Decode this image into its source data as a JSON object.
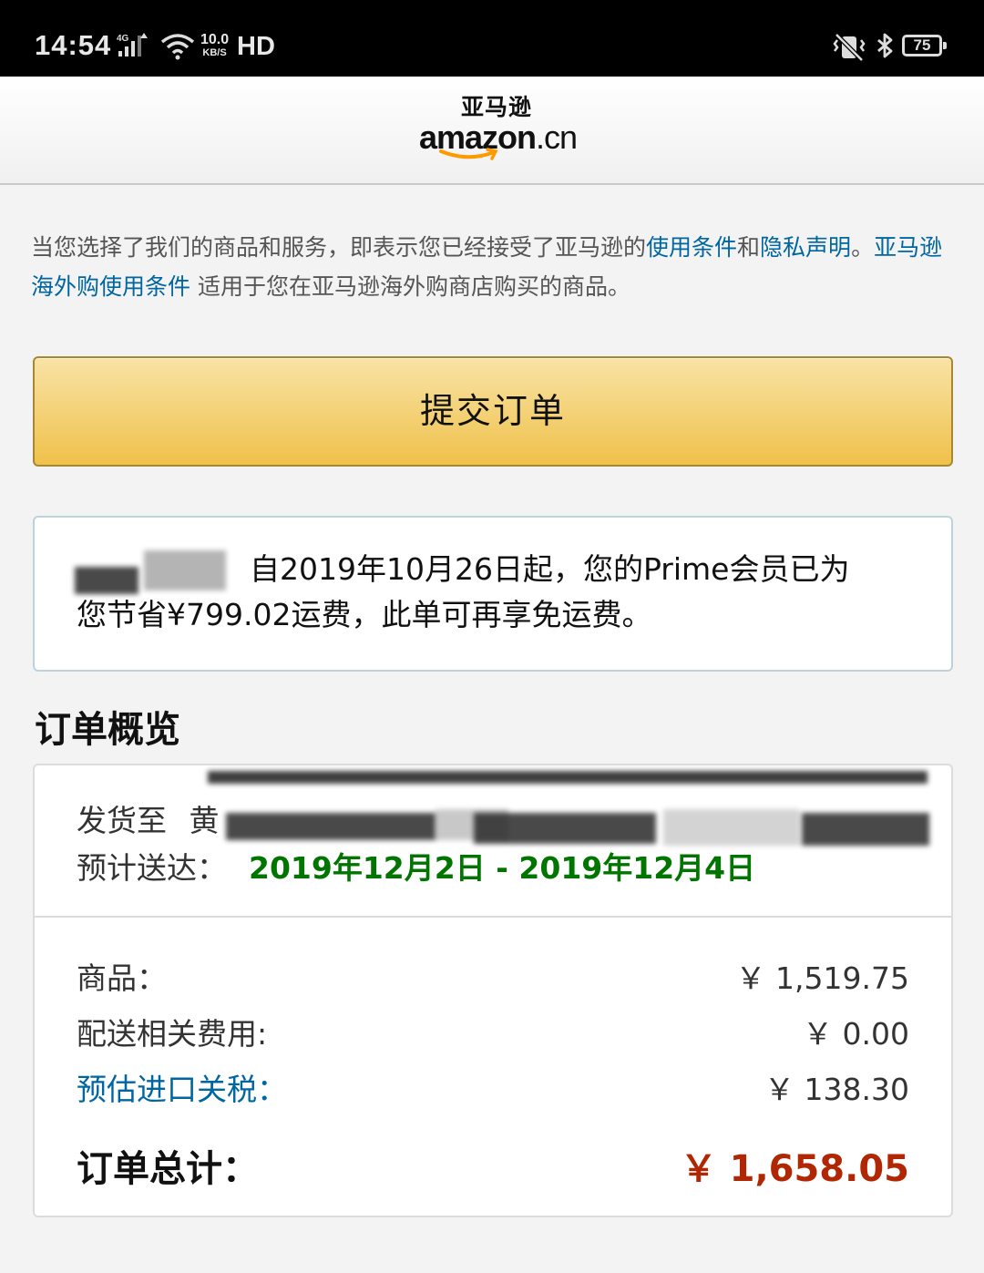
{
  "status_bar": {
    "time": "14:54",
    "network": "4G",
    "speed_value": "10.0",
    "speed_unit": "KB/S",
    "hd": "HD",
    "battery": "75"
  },
  "header": {
    "logo_cn": "亚马逊",
    "logo_en": "amazon",
    "logo_suffix": ".cn"
  },
  "terms": {
    "part1": "当您选择了我们的商品和服务，即表示您已经接受了亚马逊的",
    "link_terms": "使用条件",
    "and": "和",
    "link_privacy": "隐私声明",
    "period": "。",
    "link_overseas": "亚马逊海外购使用条件",
    "part2": " 适用于您在亚马逊海外购商店购买的商品。"
  },
  "submit_label": "提交订单",
  "prime": {
    "line1": "自2019年10月26日起，您的Prime会员已为",
    "line2": "您节省¥799.02运费，此单可再享免运费。"
  },
  "order_summary": {
    "title": "订单概览",
    "ship_to_label": "发货至",
    "ship_to_name": "黄",
    "eta_label": "预计送达：",
    "eta_date": "2019年12月2日 - 2019年12月4日",
    "lines": [
      {
        "label": "商品：",
        "value": "￥ 1,519.75"
      },
      {
        "label": "配送相关费用:",
        "value": "￥ 0.00"
      },
      {
        "label": "预估进口关税：",
        "value": "￥ 138.30"
      }
    ],
    "total_label": "订单总计：",
    "total_value": "￥ 1,658.05"
  },
  "colors": {
    "link": "#0066a1",
    "button": "#f0c14b",
    "eta": "#007600",
    "total": "#b12704"
  }
}
